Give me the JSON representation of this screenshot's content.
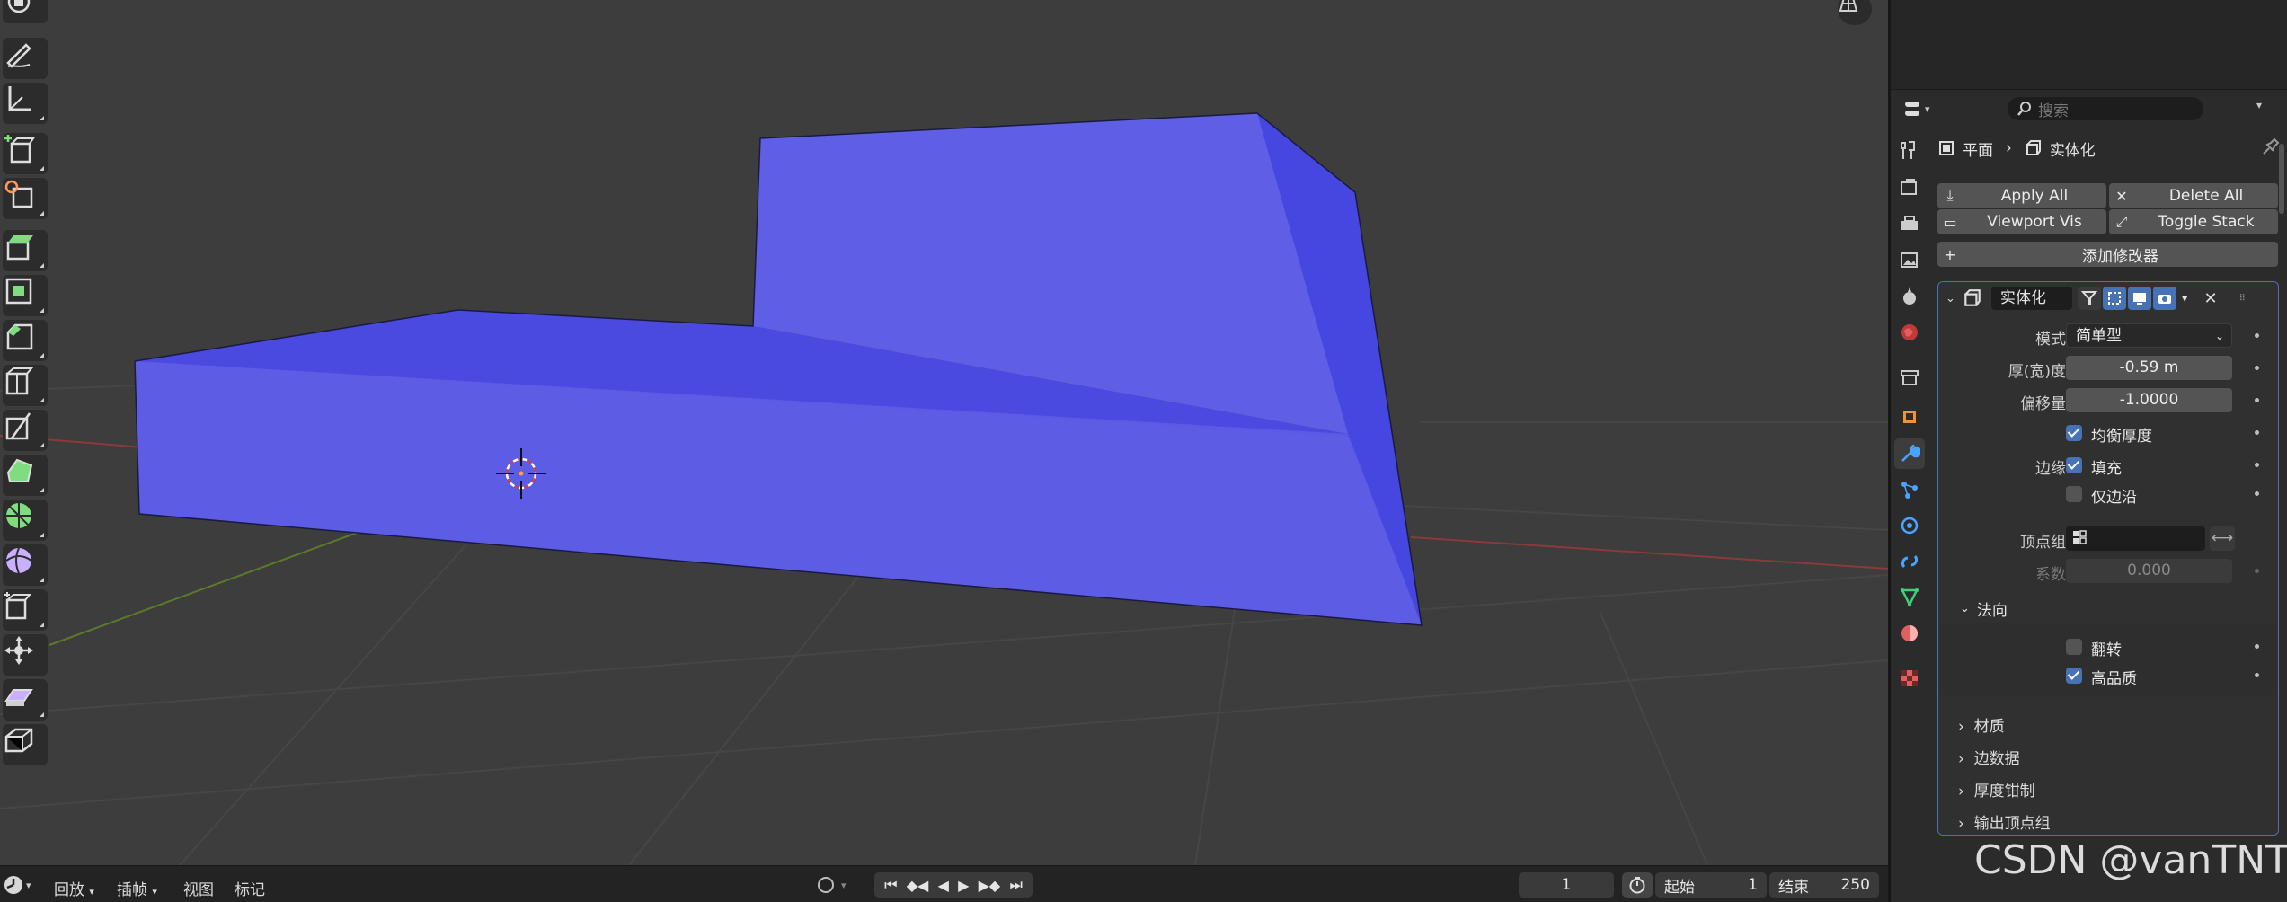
{
  "timeline": {
    "menus": [
      "回放",
      "插帧",
      "视图",
      "标记"
    ],
    "current_frame": "1",
    "start_label": "起始",
    "start_value": "1",
    "end_label": "结束",
    "end_value": "250"
  },
  "props": {
    "search_placeholder": "搜索",
    "breadcrumb_object": "平面",
    "breadcrumb_modifier": "实体化",
    "apply_all": "Apply All",
    "delete_all": "Delete All",
    "viewport_vis": "Viewport Vis",
    "toggle_stack": "Toggle Stack",
    "add_modifier": "添加修改器"
  },
  "modifier": {
    "name": "实体化",
    "mode_label": "模式",
    "mode_value": "简单型",
    "thickness_label": "厚(宽)度",
    "thickness_value": "-0.59 m",
    "offset_label": "偏移量",
    "offset_value": "-1.0000",
    "even_thickness": "均衡厚度",
    "rim_label": "边缘",
    "fill": "填充",
    "only_rim": "仅边沿",
    "vertex_group_label": "顶点组",
    "factor_label": "系数",
    "factor_value": "0.000",
    "normals_label": "法向",
    "flip": "翻转",
    "high_quality": "高品质",
    "subpanels": [
      "材质",
      "边数据",
      "厚度钳制",
      "输出顶点组"
    ]
  },
  "colors": {
    "mesh_front": "#5f5fe6",
    "mesh_dark": "#4646e0",
    "accent": "#4772b3",
    "viewport_bg": "#3d3d3d"
  },
  "watermark": "CSDN @vanTNT"
}
